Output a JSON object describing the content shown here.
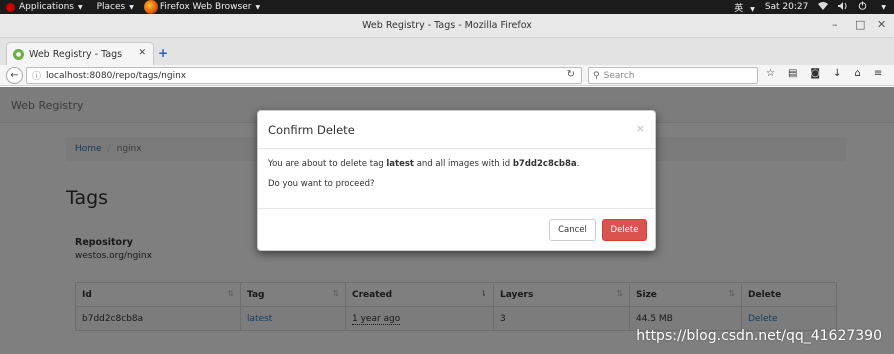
{
  "system_bar": {
    "applications": "Applications",
    "places": "Places",
    "browser": "Firefox Web Browser",
    "input_method": "英",
    "clock": "Sat 20:27"
  },
  "window": {
    "title": "Web Registry - Tags - Mozilla Firefox"
  },
  "tabs": [
    {
      "label": "Web Registry - Tags"
    }
  ],
  "navigation": {
    "url": "localhost:8080/repo/tags/nginx",
    "search_placeholder": "Search"
  },
  "app": {
    "brand": "Web Registry"
  },
  "breadcrumb": {
    "home": "Home",
    "current": "nginx"
  },
  "page": {
    "heading": "Tags",
    "repository_label": "Repository",
    "repository_value": "westos.org/nginx"
  },
  "table": {
    "columns": [
      "Id",
      "Tag",
      "Created",
      "Layers",
      "Size",
      "Delete"
    ],
    "rows": [
      {
        "id": "b7dd2c8cb8a",
        "tag": "latest",
        "created": "1 year ago",
        "layers": "3",
        "size": "44.5 MB",
        "delete": "Delete"
      }
    ]
  },
  "modal": {
    "title": "Confirm Delete",
    "close": "×",
    "body_prefix": "You are about to delete tag ",
    "tag": "latest",
    "body_middle": " and all images with id ",
    "image_id": "b7dd2c8cb8a",
    "body_suffix": ".",
    "question": "Do you want to proceed?",
    "cancel_label": "Cancel",
    "delete_label": "Delete"
  },
  "watermark": "https://blog.csdn.net/qq_41627390"
}
